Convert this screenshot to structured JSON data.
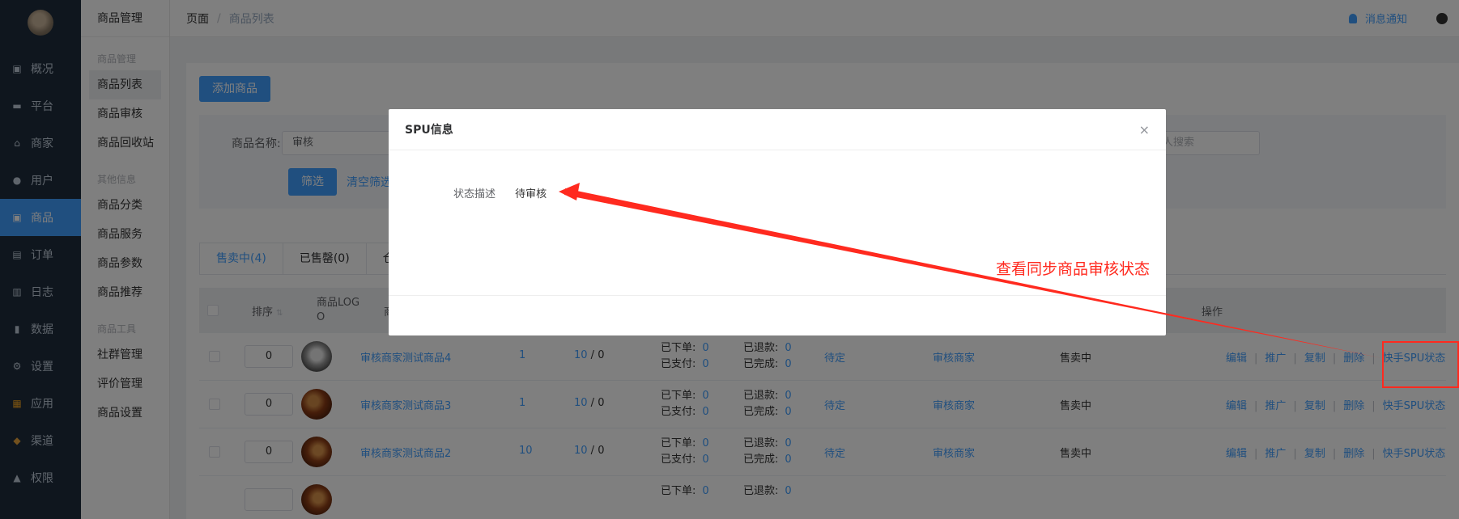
{
  "nav": {
    "items": [
      {
        "icon": "dashboard-icon",
        "label": "概况"
      },
      {
        "icon": "monitor-icon",
        "label": "平台"
      },
      {
        "icon": "store-icon",
        "label": "商家"
      },
      {
        "icon": "user-icon",
        "label": "用户"
      },
      {
        "icon": "goods-icon",
        "label": "商品"
      },
      {
        "icon": "order-icon",
        "label": "订单"
      },
      {
        "icon": "log-icon",
        "label": "日志"
      },
      {
        "icon": "chart-icon",
        "label": "数据"
      },
      {
        "icon": "gear-icon",
        "label": "设置"
      },
      {
        "icon": "apps-icon",
        "label": "应用"
      },
      {
        "icon": "channel-icon",
        "label": "渠道"
      },
      {
        "icon": "lock-icon",
        "label": "权限"
      }
    ],
    "active_index": 4
  },
  "sub": {
    "title": "商品管理",
    "group1": "商品管理",
    "g1_items": [
      "商品列表",
      "商品审核",
      "商品回收站"
    ],
    "group2": "其他信息",
    "g2_items": [
      "商品分类",
      "商品服务",
      "商品参数",
      "商品推荐"
    ],
    "group3": "商品工具",
    "g3_items": [
      "社群管理",
      "评价管理",
      "商品设置"
    ]
  },
  "topbar": {
    "crumb1": "页面",
    "sep": "/",
    "crumb2": "商品列表",
    "notify": "消息通知"
  },
  "main": {
    "add_button": "添加商品",
    "filter": {
      "name_label": "商品名称:",
      "name_value": "审核",
      "partner_placeholder": "择合伙人搜索",
      "filter_button": "筛选",
      "clear_link": "清空筛选"
    },
    "tabs": [
      "售卖中(4)",
      "已售罄(0)",
      "仓"
    ],
    "columns": {
      "sort": "排序",
      "logo_line1": "商品LOG",
      "logo_line2": "O",
      "name": "商",
      "ops": "操作"
    },
    "rows": [
      {
        "sort": "0",
        "name": "审核商家测试商品4",
        "n1": "1",
        "stock": "10",
        "stock2": " / 0",
        "ordered": "0",
        "refunded": "0",
        "paid": "0",
        "done": "0",
        "status1": "待定",
        "merchant": "审核商家",
        "state": "售卖中"
      },
      {
        "sort": "0",
        "name": "审核商家测试商品3",
        "n1": "1",
        "stock": "10",
        "stock2": " / 0",
        "ordered": "0",
        "refunded": "0",
        "paid": "0",
        "done": "0",
        "status1": "待定",
        "merchant": "审核商家",
        "state": "售卖中"
      },
      {
        "sort": "0",
        "name": "审核商家测试商品2",
        "n1": "10",
        "stock": "10",
        "stock2": " / 0",
        "ordered": "0",
        "refunded": "0",
        "paid": "0",
        "done": "0",
        "status1": "待定",
        "merchant": "审核商家",
        "state": "售卖中"
      }
    ],
    "labels": {
      "ordered": "已下单:",
      "refunded": "已退款:",
      "paid": "已支付:",
      "done": "已完成:"
    },
    "ops": [
      "编辑",
      "推广",
      "复制",
      "删除",
      "快手SPU状态"
    ],
    "row4_partial": {
      "ordered": "已下单:",
      "ordered_v": "0",
      "refunded": "已退款:",
      "refunded_v": "0"
    }
  },
  "dialog": {
    "title": "SPU信息",
    "close": "×",
    "field_label": "状态描述",
    "field_value": "待审核"
  },
  "annotation": {
    "text": "查看同步商品审核状态",
    "color": "#ff2a1f"
  }
}
